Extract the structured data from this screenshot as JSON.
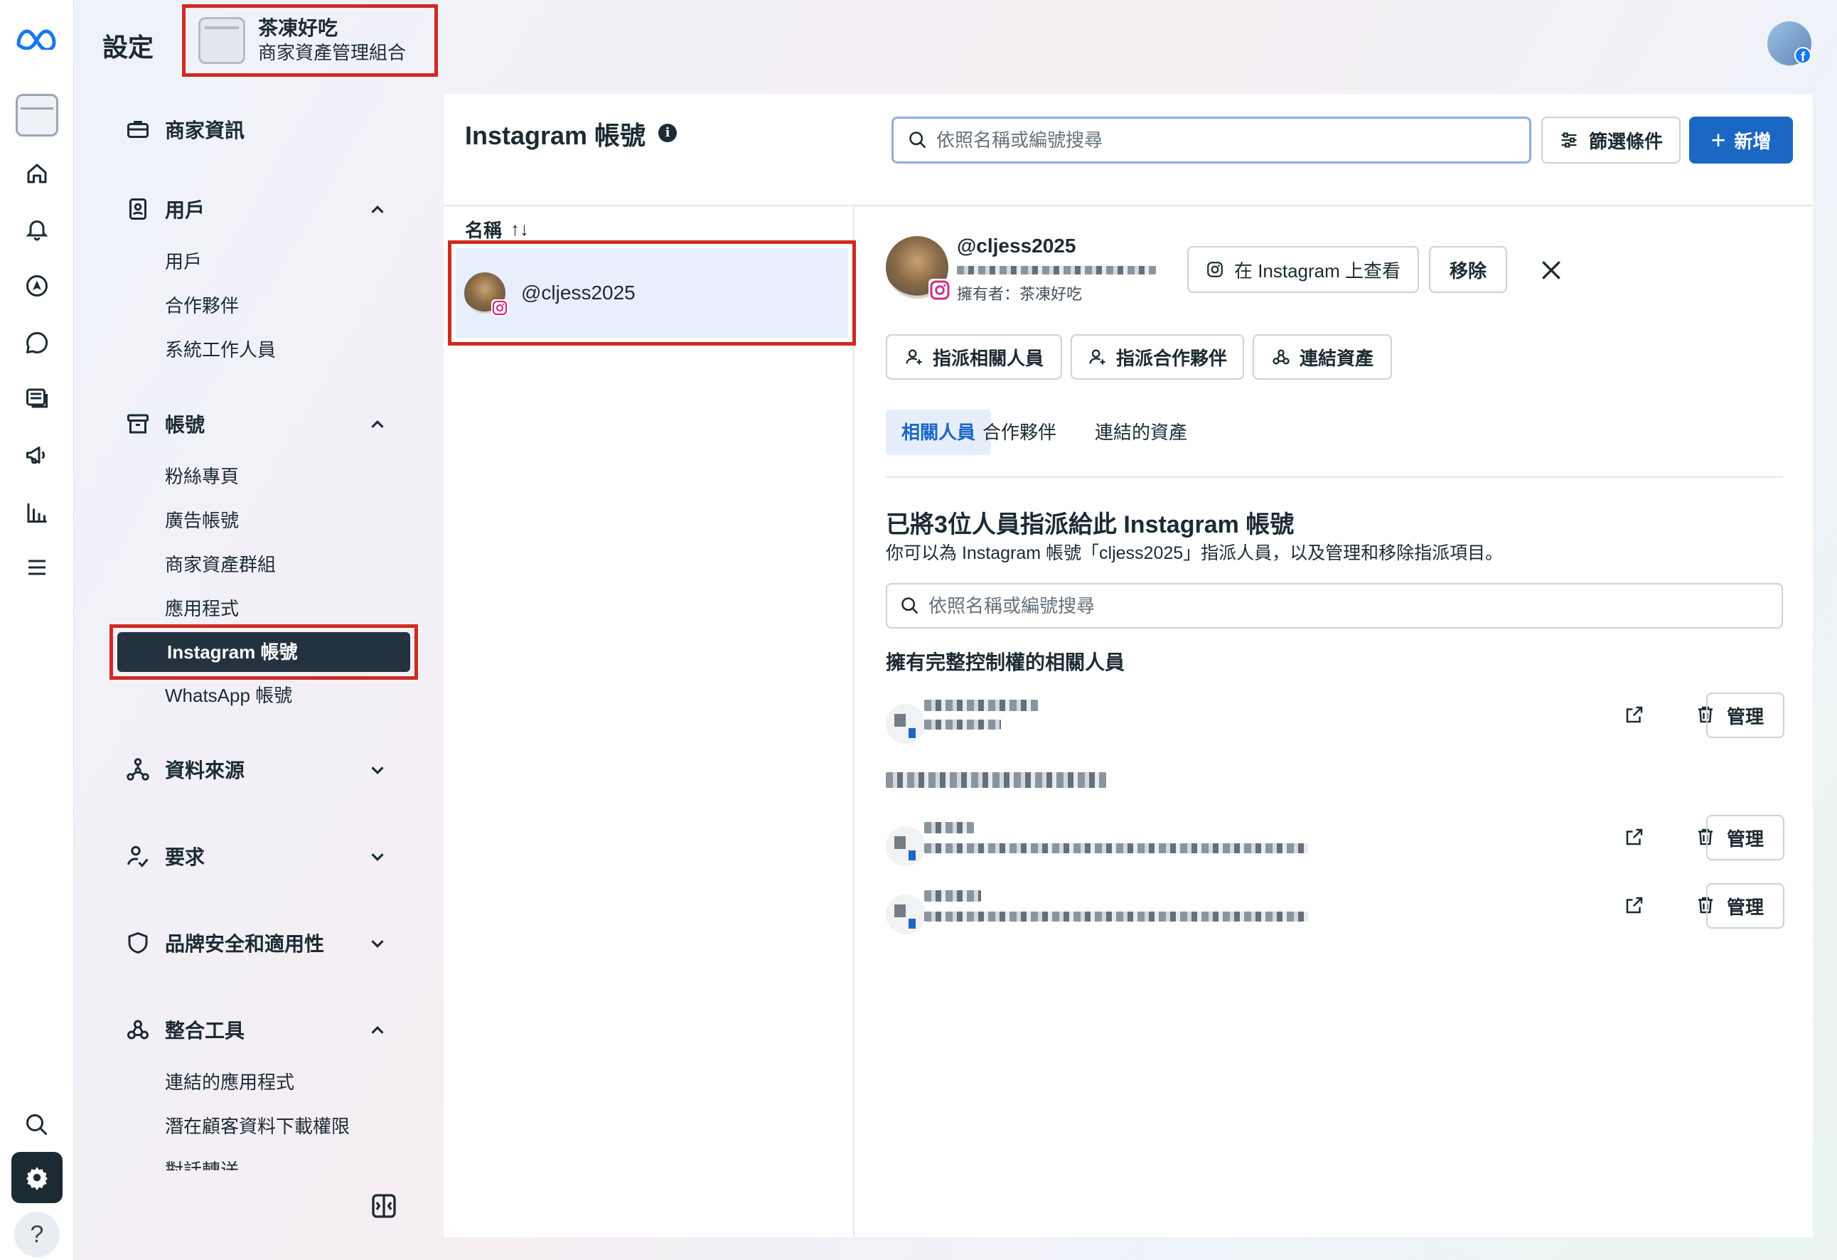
{
  "header": {
    "title": "設定",
    "business_name": "茶凍好吃",
    "business_sub": "商家資產管理組合"
  },
  "sidebar": {
    "sections": [
      {
        "label": "商家資訊",
        "icon": "briefcase-icon",
        "expanded": null
      },
      {
        "label": "用戶",
        "icon": "badge-icon",
        "expanded": true,
        "items": [
          "用戶",
          "合作夥伴",
          "系統工作人員"
        ]
      },
      {
        "label": "帳號",
        "icon": "archive-icon",
        "expanded": true,
        "items": [
          "粉絲專頁",
          "廣告帳號",
          "商家資產群組",
          "應用程式",
          "Instagram 帳號",
          "WhatsApp 帳號"
        ]
      },
      {
        "label": "資料來源",
        "icon": "data-source-icon",
        "expanded": false
      },
      {
        "label": "要求",
        "icon": "person-check-icon",
        "expanded": false
      },
      {
        "label": "品牌安全和適用性",
        "icon": "shield-icon",
        "expanded": false
      },
      {
        "label": "整合工具",
        "icon": "integrations-icon",
        "expanded": true,
        "items": [
          "連結的應用程式",
          "潛在顧客資料下載權限",
          "對話轉送"
        ]
      }
    ],
    "selected": "Instagram 帳號"
  },
  "main": {
    "title": "Instagram 帳號",
    "search_placeholder": "依照名稱或編號搜尋",
    "filter_label": "篩選條件",
    "add_label": "新增",
    "list_header": "名稱",
    "list_sort_icon": "↑↓",
    "accounts": [
      "@cljess2025"
    ]
  },
  "detail": {
    "handle": "@cljess2025",
    "owner": "擁有者：茶凍好吃",
    "view_on_instagram": "在 Instagram 上查看",
    "remove": "移除",
    "actions": [
      "指派相關人員",
      "指派合作夥伴",
      "連結資產"
    ],
    "tabs": [
      "相關人員",
      "合作夥伴",
      "連結的資產"
    ],
    "active_tab": "相關人員",
    "assign_title": "已將3位人員指派給此 Instagram 帳號",
    "assign_desc": "你可以為 Instagram 帳號「cljess2025」指派人員，以及管理和移除指派項目。",
    "search_placeholder": "依照名稱或編號搜尋",
    "full_control_title": "擁有完整控制權的相關人員",
    "manage_label": "管理"
  },
  "colors": {
    "accent": "#1a67c4",
    "highlight_border": "#cf2b20",
    "selected_nav_bg": "#243240",
    "selected_row_bg": "#e8eefb"
  }
}
